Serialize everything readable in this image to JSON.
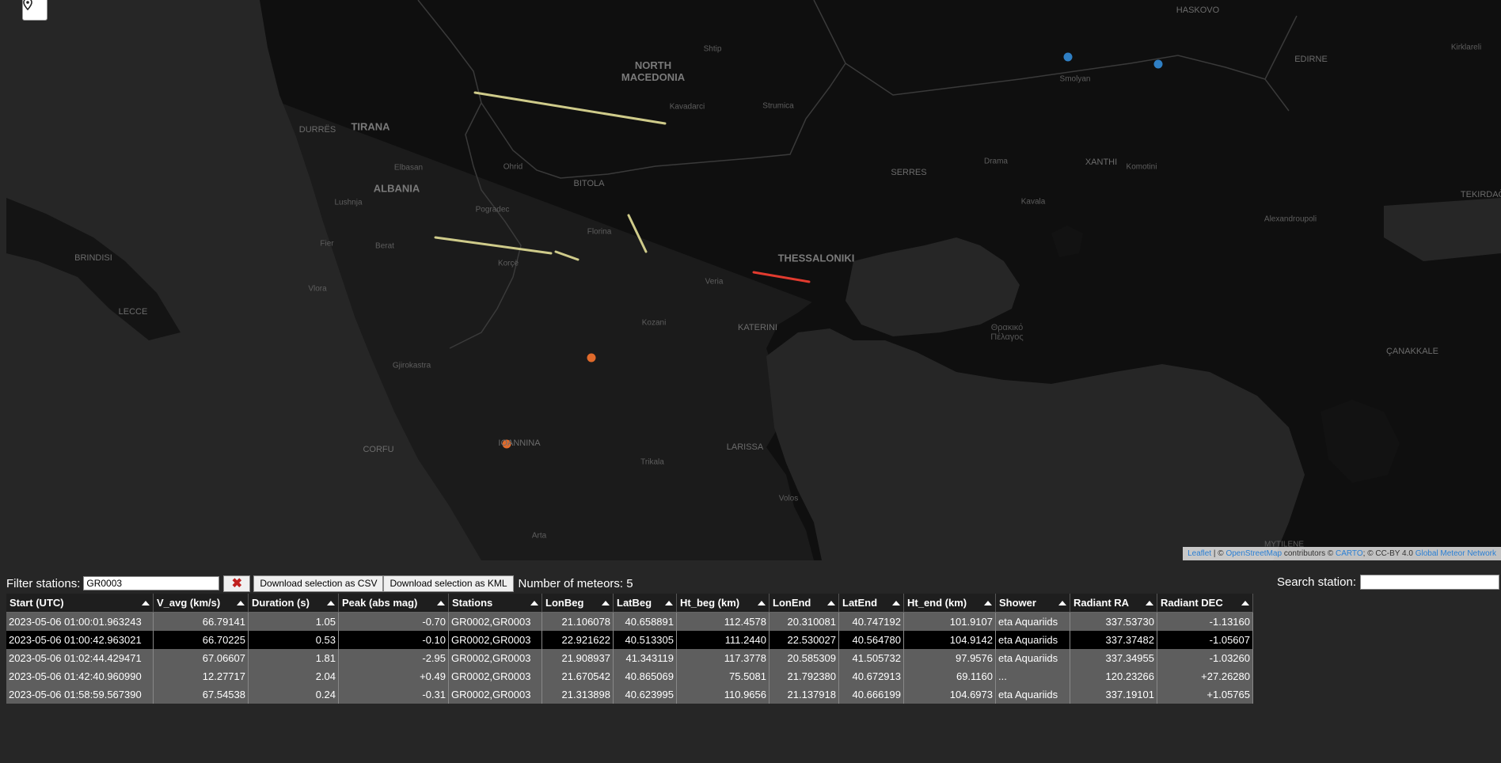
{
  "map": {
    "locate_icon": "map-marker-icon",
    "labels": [
      {
        "text": "HASKOVO",
        "style": "lbl"
      },
      {
        "text": "Kirklareli",
        "style": "small"
      },
      {
        "text": "EDIRNE",
        "style": "lbl"
      },
      {
        "text": "Smolyan",
        "style": "small"
      },
      {
        "text": "Shtip",
        "style": "small"
      },
      {
        "text": "NORTH\nMACEDONIA",
        "style": "big"
      },
      {
        "text": "Kavadarci",
        "style": "small"
      },
      {
        "text": "Strumica",
        "style": "small"
      },
      {
        "text": "DURRËS",
        "style": "lbl"
      },
      {
        "text": "TIRANA",
        "style": "big"
      },
      {
        "text": "Elbasan",
        "style": "small"
      },
      {
        "text": "ALBANIA",
        "style": "big"
      },
      {
        "text": "Ohrid",
        "style": "small"
      },
      {
        "text": "BITOLA",
        "style": "lbl"
      },
      {
        "text": "SERRES",
        "style": "lbl"
      },
      {
        "text": "Drama",
        "style": "small"
      },
      {
        "text": "XANTHI",
        "style": "lbl"
      },
      {
        "text": "Komotini",
        "style": "small"
      },
      {
        "text": "TEKIRDAĞ",
        "style": "lbl"
      },
      {
        "text": "Kavala",
        "style": "small"
      },
      {
        "text": "Alexandroupoli",
        "style": "small"
      },
      {
        "text": "Lushnja",
        "style": "small"
      },
      {
        "text": "Pogradec",
        "style": "small"
      },
      {
        "text": "Florina",
        "style": "small"
      },
      {
        "text": "Fier",
        "style": "small"
      },
      {
        "text": "Berat",
        "style": "small"
      },
      {
        "text": "BRINDISI",
        "style": "lbl"
      },
      {
        "text": "Korçë",
        "style": "small"
      },
      {
        "text": "THESSALONIKI",
        "style": "big"
      },
      {
        "text": "Vlora",
        "style": "small"
      },
      {
        "text": "Veria",
        "style": "small"
      },
      {
        "text": "LECCE",
        "style": "lbl"
      },
      {
        "text": "Kozani",
        "style": "small"
      },
      {
        "text": "KATERINI",
        "style": "lbl"
      },
      {
        "text": "Θρακικό\nΠέλαγος",
        "style": "sea"
      },
      {
        "text": "ÇANAKKALE",
        "style": "lbl"
      },
      {
        "text": "Gjirokastra",
        "style": "small"
      },
      {
        "text": "CORFU",
        "style": "lbl"
      },
      {
        "text": "IOANNINA",
        "style": "lbl"
      },
      {
        "text": "LARISSA",
        "style": "lbl"
      },
      {
        "text": "Trikala",
        "style": "small"
      },
      {
        "text": "Volos",
        "style": "small"
      },
      {
        "text": "Arta",
        "style": "small"
      },
      {
        "text": "MYTILENE",
        "style": "small"
      }
    ],
    "attribution": {
      "leaflet": "Leaflet",
      "sep1": " | © ",
      "osm": "OpenStreetMap",
      "contrib": " contributors © ",
      "carto": "CARTO",
      "license": "; © CC-BY 4.0 ",
      "gmn": "Global Meteor Network"
    },
    "station_color_blue": "#2f7fc4",
    "station_color_orange": "#e06a2b",
    "trail_color": "#d9d6a0",
    "trail_color_red": "#e0302a"
  },
  "controls": {
    "filter_label": "Filter stations:",
    "filter_value": "GR0003",
    "clear_icon": "close-x-icon",
    "download_csv": "Download selection as CSV",
    "download_kml": "Download selection as KML",
    "meteor_count": "Number of meteors: 5",
    "search_label": "Search station:",
    "search_value": ""
  },
  "table": {
    "headers": [
      "Start (UTC)",
      "V_avg (km/s)",
      "Duration (s)",
      "Peak (abs mag)",
      "Stations",
      "LonBeg",
      "LatBeg",
      "Ht_beg (km)",
      "LonEnd",
      "LatEnd",
      "Ht_end (km)",
      "Shower",
      "Radiant RA",
      "Radiant DEC"
    ],
    "rows": [
      [
        "2023-05-06 01:00:01.963243",
        "66.79141",
        "1.05",
        "-0.70",
        "GR0002,GR0003",
        "21.106078",
        "40.658891",
        "112.4578",
        "20.310081",
        "40.747192",
        "101.9107",
        "eta Aquariids",
        "337.53730",
        "-1.13160"
      ],
      [
        "2023-05-06 01:00:42.963021",
        "66.70225",
        "0.53",
        "-0.10",
        "GR0002,GR0003",
        "22.921622",
        "40.513305",
        "111.2440",
        "22.530027",
        "40.564780",
        "104.9142",
        "eta Aquariids",
        "337.37482",
        "-1.05607"
      ],
      [
        "2023-05-06 01:02:44.429471",
        "67.06607",
        "1.81",
        "-2.95",
        "GR0002,GR0003",
        "21.908937",
        "41.343119",
        "117.3778",
        "20.585309",
        "41.505732",
        "97.9576",
        "eta Aquariids",
        "337.34955",
        "-1.03260"
      ],
      [
        "2023-05-06 01:42:40.960990",
        "12.27717",
        "2.04",
        "+0.49",
        "GR0002,GR0003",
        "21.670542",
        "40.865069",
        "75.5081",
        "21.792380",
        "40.672913",
        "69.1160",
        "...",
        "120.23266",
        "+27.26280"
      ],
      [
        "2023-05-06 01:58:59.567390",
        "67.54538",
        "0.24",
        "-0.31",
        "GR0002,GR0003",
        "21.313898",
        "40.623995",
        "110.9656",
        "21.137918",
        "40.666199",
        "104.6973",
        "eta Aquariids",
        "337.19101",
        "+1.05765"
      ]
    ]
  }
}
